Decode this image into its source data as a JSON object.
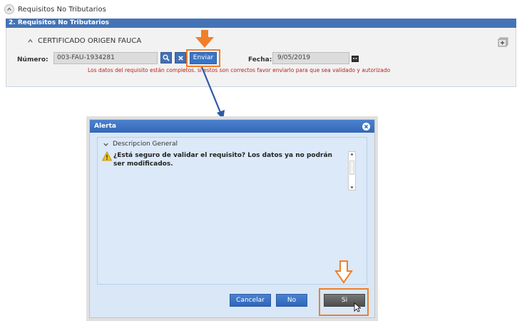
{
  "header": {
    "title": "Requisitos No Tributarios",
    "collapse_icon": "chevron-up-icon"
  },
  "section": {
    "title": "2. Requisitos No Tributarios",
    "item_title": "CERTIFICADO ORIGEN FAUCA",
    "numero_label": "Número:",
    "numero_value": "003-FAU-1934281",
    "enviar_label": "Enviar",
    "fecha_label": "Fecha:",
    "fecha_value": "9/05/2019",
    "status_message": "Los datos del requisito están completos. si estos son correctos favor enviarlo para que sea validado y autorizado",
    "icons": [
      "search-icon",
      "close-icon",
      "calendar-icon",
      "add-icon"
    ]
  },
  "dialog": {
    "title": "Alerta",
    "desc_header": "Descripcion General",
    "message": "¿Está seguro de validar el requisito? Los datos ya no podrán ser modificados.",
    "buttons": {
      "cancel": "Cancelar",
      "no": "No",
      "yes": "Si"
    }
  },
  "colors": {
    "accent_blue": "#4473b6",
    "highlight_orange": "#f07f2a",
    "status_red": "#b92121",
    "dialog_bg": "#d9e7f7"
  }
}
